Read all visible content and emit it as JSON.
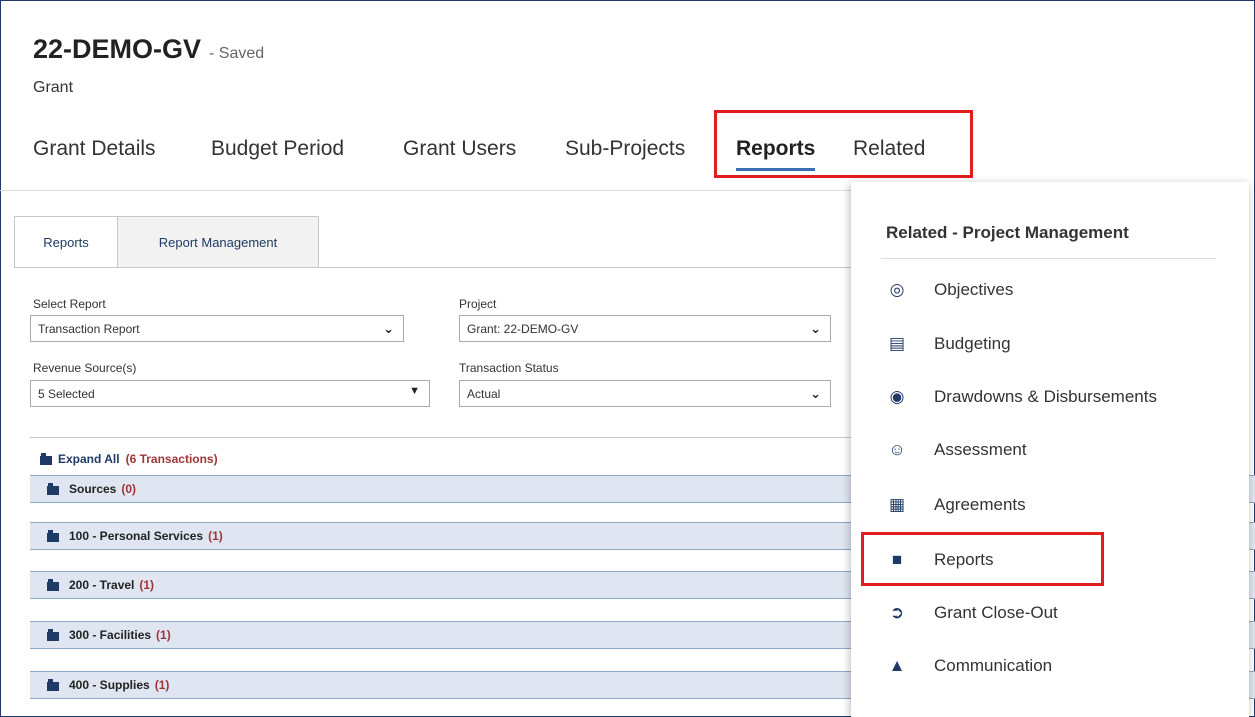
{
  "header": {
    "title": "22-DEMO-GV",
    "saved": "- Saved",
    "subtitle": "Grant"
  },
  "tabs": [
    {
      "label": "Grant Details"
    },
    {
      "label": "Budget Period"
    },
    {
      "label": "Grant Users"
    },
    {
      "label": "Sub-Projects"
    },
    {
      "label": "Reports"
    },
    {
      "label": "Related"
    }
  ],
  "subtabs": [
    "Reports",
    "Report Management"
  ],
  "form": {
    "select_report_label": "Select Report",
    "select_report_value": "Transaction Report",
    "project_label": "Project",
    "project_value": "Grant: 22-DEMO-GV",
    "revenue_label": "Revenue Source(s)",
    "revenue_value": "5 Selected",
    "status_label": "Transaction Status",
    "status_value": "Actual"
  },
  "expand_all": {
    "label": "Expand All",
    "count": "(6 Transactions)"
  },
  "groups": [
    {
      "name": "Sources",
      "count": "(0)"
    },
    {
      "name": "100 - Personal Services",
      "count": "(1)"
    },
    {
      "name": "200 - Travel",
      "count": "(1)"
    },
    {
      "name": "300 - Facilities",
      "count": "(1)"
    },
    {
      "name": "400 - Supplies",
      "count": "(1)"
    }
  ],
  "related_menu": {
    "title": "Related - Project Management",
    "items": [
      {
        "label": "Objectives",
        "icon": "target-icon"
      },
      {
        "label": "Budgeting",
        "icon": "budget-icon"
      },
      {
        "label": "Drawdowns & Disbursements",
        "icon": "money-bag-icon"
      },
      {
        "label": "Assessment",
        "icon": "assessment-icon"
      },
      {
        "label": "Agreements",
        "icon": "agreement-icon"
      },
      {
        "label": "Reports",
        "icon": "chart-icon"
      },
      {
        "label": "Grant Close-Out",
        "icon": "close-out-icon"
      },
      {
        "label": "Communication",
        "icon": "chat-icon"
      }
    ]
  },
  "colors": {
    "highlight": "#e01e1e",
    "accent": "#3b6fb3",
    "navy": "#1f3a66",
    "count_red": "#a03535",
    "group_bg": "#dfe6f1"
  }
}
